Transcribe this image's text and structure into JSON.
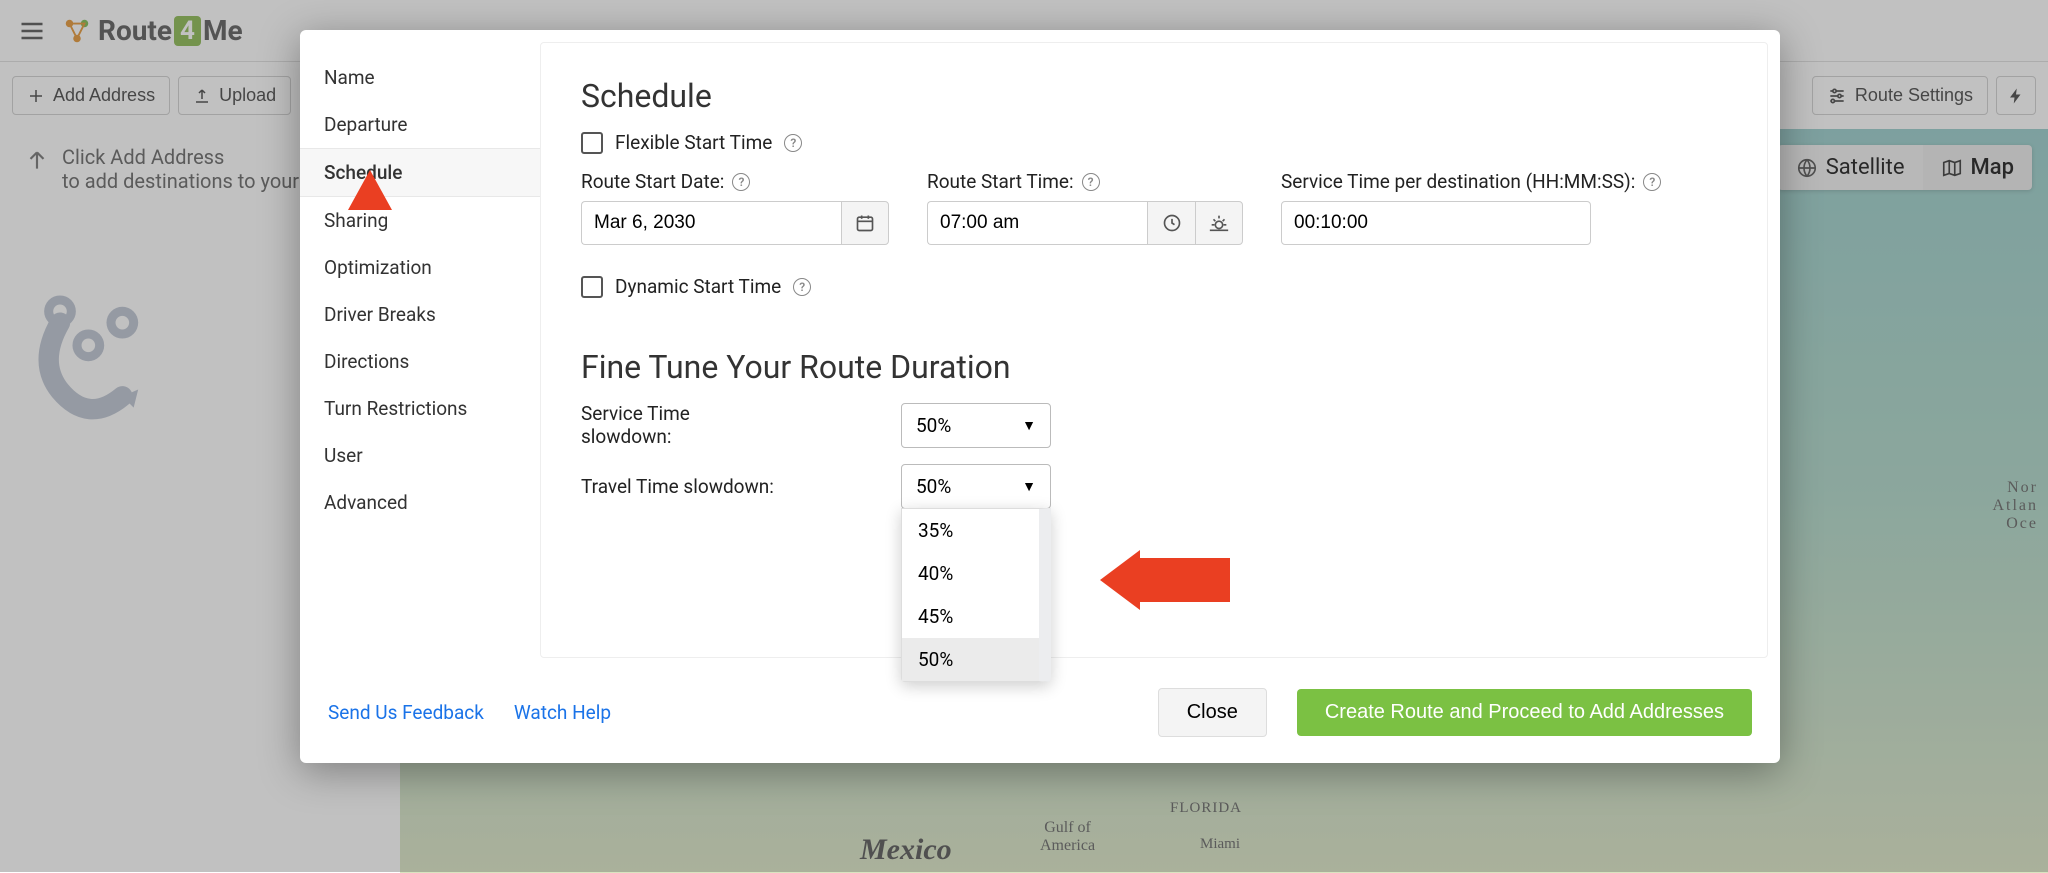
{
  "app": {
    "brand_prefix": "Route",
    "brand_mid": "4",
    "brand_suffix": "Me"
  },
  "toolbar": {
    "add_address": "Add Address",
    "upload": "Upload",
    "route_settings": "Route Settings"
  },
  "hint": {
    "line1": "Click Add Address",
    "line2": "to add destinations to your"
  },
  "map": {
    "satellite": "Satellite",
    "map": "Map",
    "mexico": "Mexico",
    "gulf": "Gulf of\nAmerica",
    "florida": "FLORIDA",
    "miami": "Miami",
    "atl": "Nor\nAtlan\nOce"
  },
  "modal": {
    "nav": {
      "name": "Name",
      "departure": "Departure",
      "schedule": "Schedule",
      "sharing": "Sharing",
      "optimization": "Optimization",
      "driver_breaks": "Driver Breaks",
      "directions": "Directions",
      "turn_restrictions": "Turn Restrictions",
      "user": "User",
      "advanced": "Advanced"
    },
    "schedule": {
      "heading": "Schedule",
      "flexible": "Flexible Start Time",
      "route_start_date_label": "Route Start Date:",
      "route_start_date": "Mar 6, 2030",
      "route_start_time_label": "Route Start Time:",
      "route_start_time": "07:00 am",
      "service_time_label": "Service Time per destination (HH:MM:SS):",
      "service_time": "00:10:00",
      "dynamic": "Dynamic Start Time",
      "fine_tune": "Fine Tune Your Route Duration",
      "service_slow_label": "Service Time slowdown:",
      "service_slow_value": "50%",
      "travel_slow_label": "Travel Time slowdown:",
      "travel_slow_value": "50%",
      "dropdown": {
        "opt35": "35%",
        "opt40": "40%",
        "opt45": "45%",
        "opt50": "50%"
      }
    },
    "footer": {
      "feedback": "Send Us Feedback",
      "watch": "Watch Help",
      "close": "Close",
      "create": "Create Route and Proceed to Add Addresses"
    }
  }
}
